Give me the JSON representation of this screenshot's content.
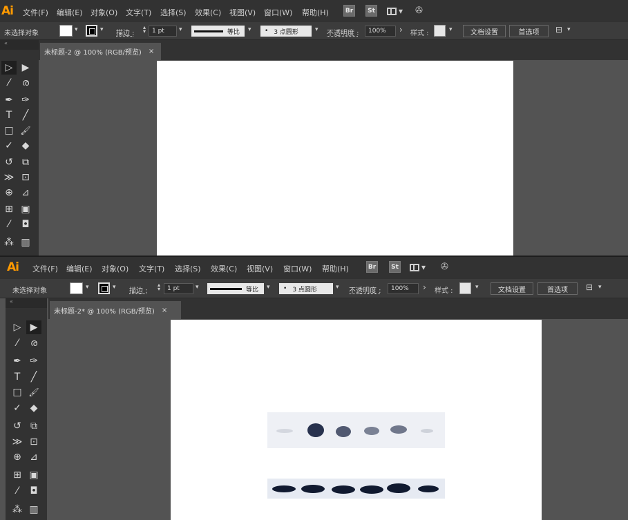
{
  "app": {
    "logo": "Ai"
  },
  "menu": [
    "文件(F)",
    "编辑(E)",
    "对象(O)",
    "文字(T)",
    "选择(S)",
    "效果(C)",
    "视图(V)",
    "窗口(W)",
    "帮助(H)"
  ],
  "bridge_label": "Br",
  "stock_label": "St",
  "control": {
    "selection_status": "未选择对象",
    "stroke_label": "描边 :",
    "stroke_weight": "1 pt",
    "profile_label": "等比",
    "brush_label": "3 点圆形",
    "brush_dot": "•",
    "opacity_label": "不透明度 :",
    "opacity_value": "100%",
    "style_label": "样式 :",
    "doc_setup": "文档设置",
    "preferences": "首选项"
  },
  "windows": [
    {
      "tab_title": "未标题-2 @ 100% (RGB/预览)"
    },
    {
      "tab_title": "未标题-2* @ 100% (RGB/预览)"
    }
  ],
  "tab_close": "×",
  "toolbox_collapse": "«",
  "icons": {
    "dropdown": "▾",
    "arrow_right": "›",
    "spin": "◇",
    "selection_tool": "▷",
    "direct_selection_tool": "▶",
    "magic_wand_tool": "⁄",
    "lasso_tool": "ര",
    "pen_tool": "✒",
    "curvature_tool": "✑",
    "type_tool": "T",
    "line_tool": "╱",
    "rectangle_tool": "□",
    "paintbrush_tool": "🖌",
    "shaper_tool": "✓",
    "eraser_tool": "◆",
    "rotate_tool": "↺",
    "scale_tool": "⧉",
    "width_tool": "≫",
    "free_transform_tool": "⊡",
    "shape_builder_tool": "⊕",
    "perspective_grid_tool": "⊿",
    "mesh_tool": "⊞",
    "gradient_tool": "▣",
    "eyedropper_tool": "⁄",
    "blend_tool": "◘",
    "symbol_sprayer_tool": "⁂",
    "column_graph_tool": "▥"
  },
  "blot": {
    "band_fill": "#1c2744",
    "strip_bg": "#e9ecf3"
  }
}
